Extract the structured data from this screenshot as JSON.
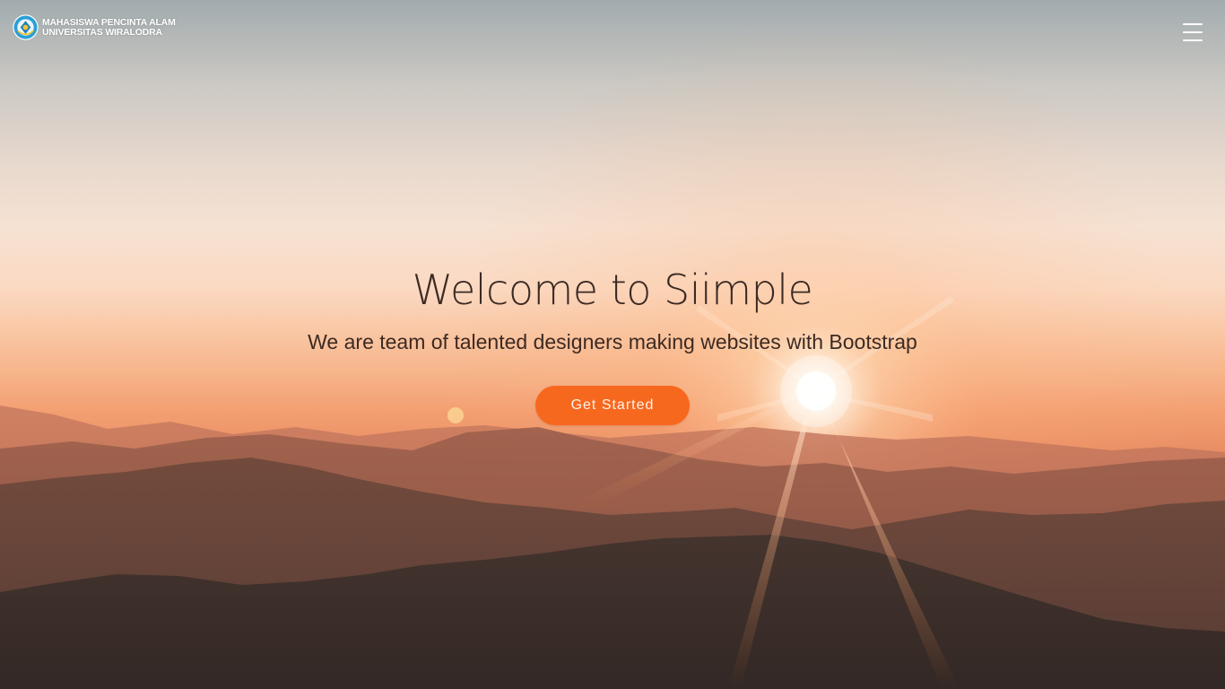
{
  "header": {
    "logo": {
      "line1": "MAHASISWA PENCINTA ALAM",
      "line2": "UNIVERSITAS WIRALODRA",
      "icon": "university-emblem-icon"
    },
    "menu_icon": "hamburger-menu-icon"
  },
  "hero": {
    "title": "Welcome to Siimple",
    "subtitle": "We are team of talented designers making websites with Bootstrap",
    "cta_label": "Get Started",
    "background": "sunset-over-mountains-photo"
  },
  "colors": {
    "accent": "#f7681f",
    "text_dark": "#3b2a24",
    "white": "#ffffff"
  }
}
